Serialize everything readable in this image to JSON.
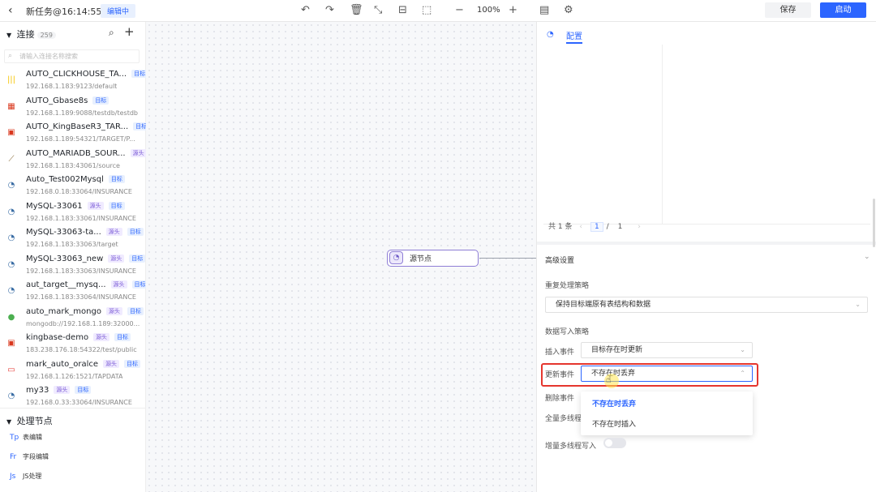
{
  "header": {
    "title": "新任务@16:14:55",
    "badge": "编辑中",
    "zoom": "100%",
    "save_label": "保存",
    "start_label": "启动",
    "icons": [
      "undo-icon",
      "redo-icon",
      "delete-icon",
      "fit-icon",
      "layout-icon",
      "select-icon",
      "zoom-out-icon",
      "zoom-in-icon",
      "logs-icon",
      "settings-icon"
    ]
  },
  "sidebar": {
    "connections_title": "连接",
    "connections_count": "259",
    "search_placeholder": "请输入连接名称搜索",
    "connections": [
      {
        "name": "AUTO_CLICKHOUSE_TA...",
        "tags": [
          "目标"
        ],
        "addr": "192.168.1.183:9123/default",
        "icon": "clickhouse-icon",
        "color": "#f5c400"
      },
      {
        "name": "AUTO_Gbase8s",
        "tags": [
          "目标"
        ],
        "addr": "192.168.1.189:9088/testdb/testdb",
        "icon": "gbase-icon",
        "color": "#d9381e"
      },
      {
        "name": "AUTO_KingBaseR3_TAR...",
        "tags": [
          "目标"
        ],
        "addr": "192.168.1.189:54321/TARGET/P...",
        "icon": "kingbase-icon",
        "color": "#d9381e"
      },
      {
        "name": "AUTO_MARIADB_SOUR...",
        "tags": [
          "源头"
        ],
        "addr": "192.168.1.183:43061/source",
        "icon": "mariadb-icon",
        "color": "#8a6d3b"
      },
      {
        "name": "Auto_Test002Mysql",
        "tags": [
          "目标"
        ],
        "addr": "192.168.0.18:33064/INSURANCE",
        "icon": "mysql-icon",
        "color": "#3b6ea5"
      },
      {
        "name": "MySQL-33061",
        "tags": [
          "源头",
          "目标"
        ],
        "addr": "192.168.1.183:33061/INSURANCE",
        "icon": "mysql-icon",
        "color": "#3b6ea5"
      },
      {
        "name": "MySQL-33063-ta...",
        "tags": [
          "源头",
          "目标"
        ],
        "addr": "192.168.1.183:33063/target",
        "icon": "mysql-icon",
        "color": "#3b6ea5"
      },
      {
        "name": "MySQL-33063_new",
        "tags": [
          "源头",
          "目标"
        ],
        "addr": "192.168.1.183:33063/INSURANCE",
        "icon": "mysql-icon",
        "color": "#3b6ea5"
      },
      {
        "name": "aut_target__mysq...",
        "tags": [
          "源头",
          "目标"
        ],
        "addr": "192.168.1.183:33064/INSURANCE",
        "icon": "mysql-icon",
        "color": "#3b6ea5"
      },
      {
        "name": "auto_mark_mongo",
        "tags": [
          "源头",
          "目标"
        ],
        "addr": "mongodb://192.168.1.189:32000...",
        "icon": "mongodb-icon",
        "color": "#4caf50"
      },
      {
        "name": "kingbase-demo",
        "tags": [
          "源头",
          "目标"
        ],
        "addr": "183.238.176.18:54322/test/public",
        "icon": "kingbase-icon",
        "color": "#d9381e"
      },
      {
        "name": "mark_auto_oralce",
        "tags": [
          "源头",
          "目标"
        ],
        "addr": "192.168.1.126:1521/TAPDATA",
        "icon": "oracle-icon",
        "color": "#e53935"
      },
      {
        "name": "my33",
        "tags": [
          "源头",
          "目标"
        ],
        "addr": "192.168.0.33:33064/INSURANCE",
        "icon": "mysql-icon",
        "color": "#3b6ea5"
      }
    ],
    "processing_title": "处理节点",
    "processing": [
      {
        "abbr": "Tp",
        "label": "表编辑"
      },
      {
        "abbr": "Fr",
        "label": "字段编辑"
      },
      {
        "abbr": "Js",
        "label": "JS处理"
      }
    ]
  },
  "canvas": {
    "node_label": "源节点"
  },
  "panel": {
    "tab_label": "配置",
    "pager": {
      "total": "共 1 条",
      "current": "1",
      "separator": "/",
      "pages": "1"
    },
    "advanced_label": "高级设置",
    "dup_strategy_label": "重复处理策略",
    "dup_strategy_value": "保持目标端原有表结构和数据",
    "write_strategy_label": "数据写入策略",
    "insert_label": "插入事件",
    "insert_value": "目标存在时更新",
    "update_label": "更新事件",
    "update_value": "不存在时丢弃",
    "delete_label": "删除事件",
    "full_multithread_label": "全量多线程",
    "incr_multithread_label": "增量多线程写入",
    "dropdown_options": [
      "不存在时丢弃",
      "不存在时插入"
    ]
  },
  "colors": {
    "accent": "#2c65ff",
    "highlight": "#e5362e",
    "node_border": "#8f7ed6"
  }
}
